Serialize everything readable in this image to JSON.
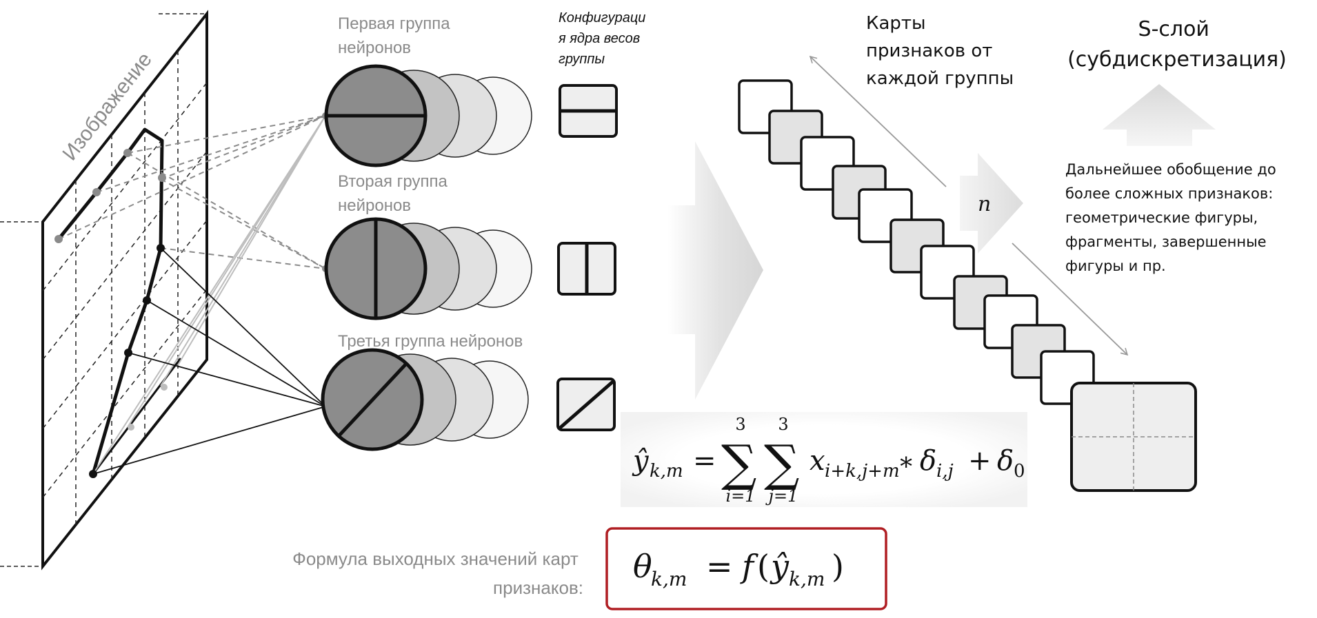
{
  "image_label": "Изображение",
  "groups": [
    {
      "label_lines": [
        "Первая группа",
        "нейронов"
      ],
      "kernel": "horizontal"
    },
    {
      "label_lines": [
        "Вторая группа",
        "нейронов"
      ],
      "kernel": "vertical"
    },
    {
      "label_lines": [
        "Третья группа нейронов"
      ],
      "kernel": "diagonal"
    }
  ],
  "kernel_caption_lines": [
    "Конфигураци",
    "я ядра весов",
    "группы"
  ],
  "feature_maps_lines": [
    "Карты",
    "признаков от",
    "каждой группы"
  ],
  "n_label": "n",
  "s_layer_lines": [
    "S-слой",
    "(субдискретизация)"
  ],
  "generalization_lines": [
    "Дальнейшее обобщение до",
    "более сложных признаков:",
    "геометрические фигуры,",
    "фрагменты, завершенные",
    "фигуры и пр."
  ],
  "formula1": {
    "lhs": "ŷ",
    "lhs_sub": "k,m",
    "eq": "=",
    "sum_sign": "∑",
    "sum1_lower": "i=1",
    "sum1_upper": "3",
    "sum2_lower": "j=1",
    "sum2_upper": "3",
    "x": "x",
    "x_sub": "i+k,j+m",
    "times": "∗",
    "delta": "δ",
    "delta_sub": "i,j",
    "plus": "+",
    "delta0": "δ",
    "delta0_sub": "0"
  },
  "formula2_caption_lines": [
    "Формула выходных значений карт",
    "признаков:"
  ],
  "formula2": {
    "theta": "θ",
    "theta_sub": "k,m",
    "eq": "=",
    "f": "f",
    "open": "(",
    "y": "ŷ",
    "y_sub": "k,m",
    "close": ")"
  },
  "colors": {
    "formula_box_border": "#b01e23",
    "neuron_dark": "#8c8c8c",
    "kernel_fill": "#eeeeee",
    "map_gray": "#e3e3e3",
    "dashed_gray": "#8a8a8a"
  }
}
